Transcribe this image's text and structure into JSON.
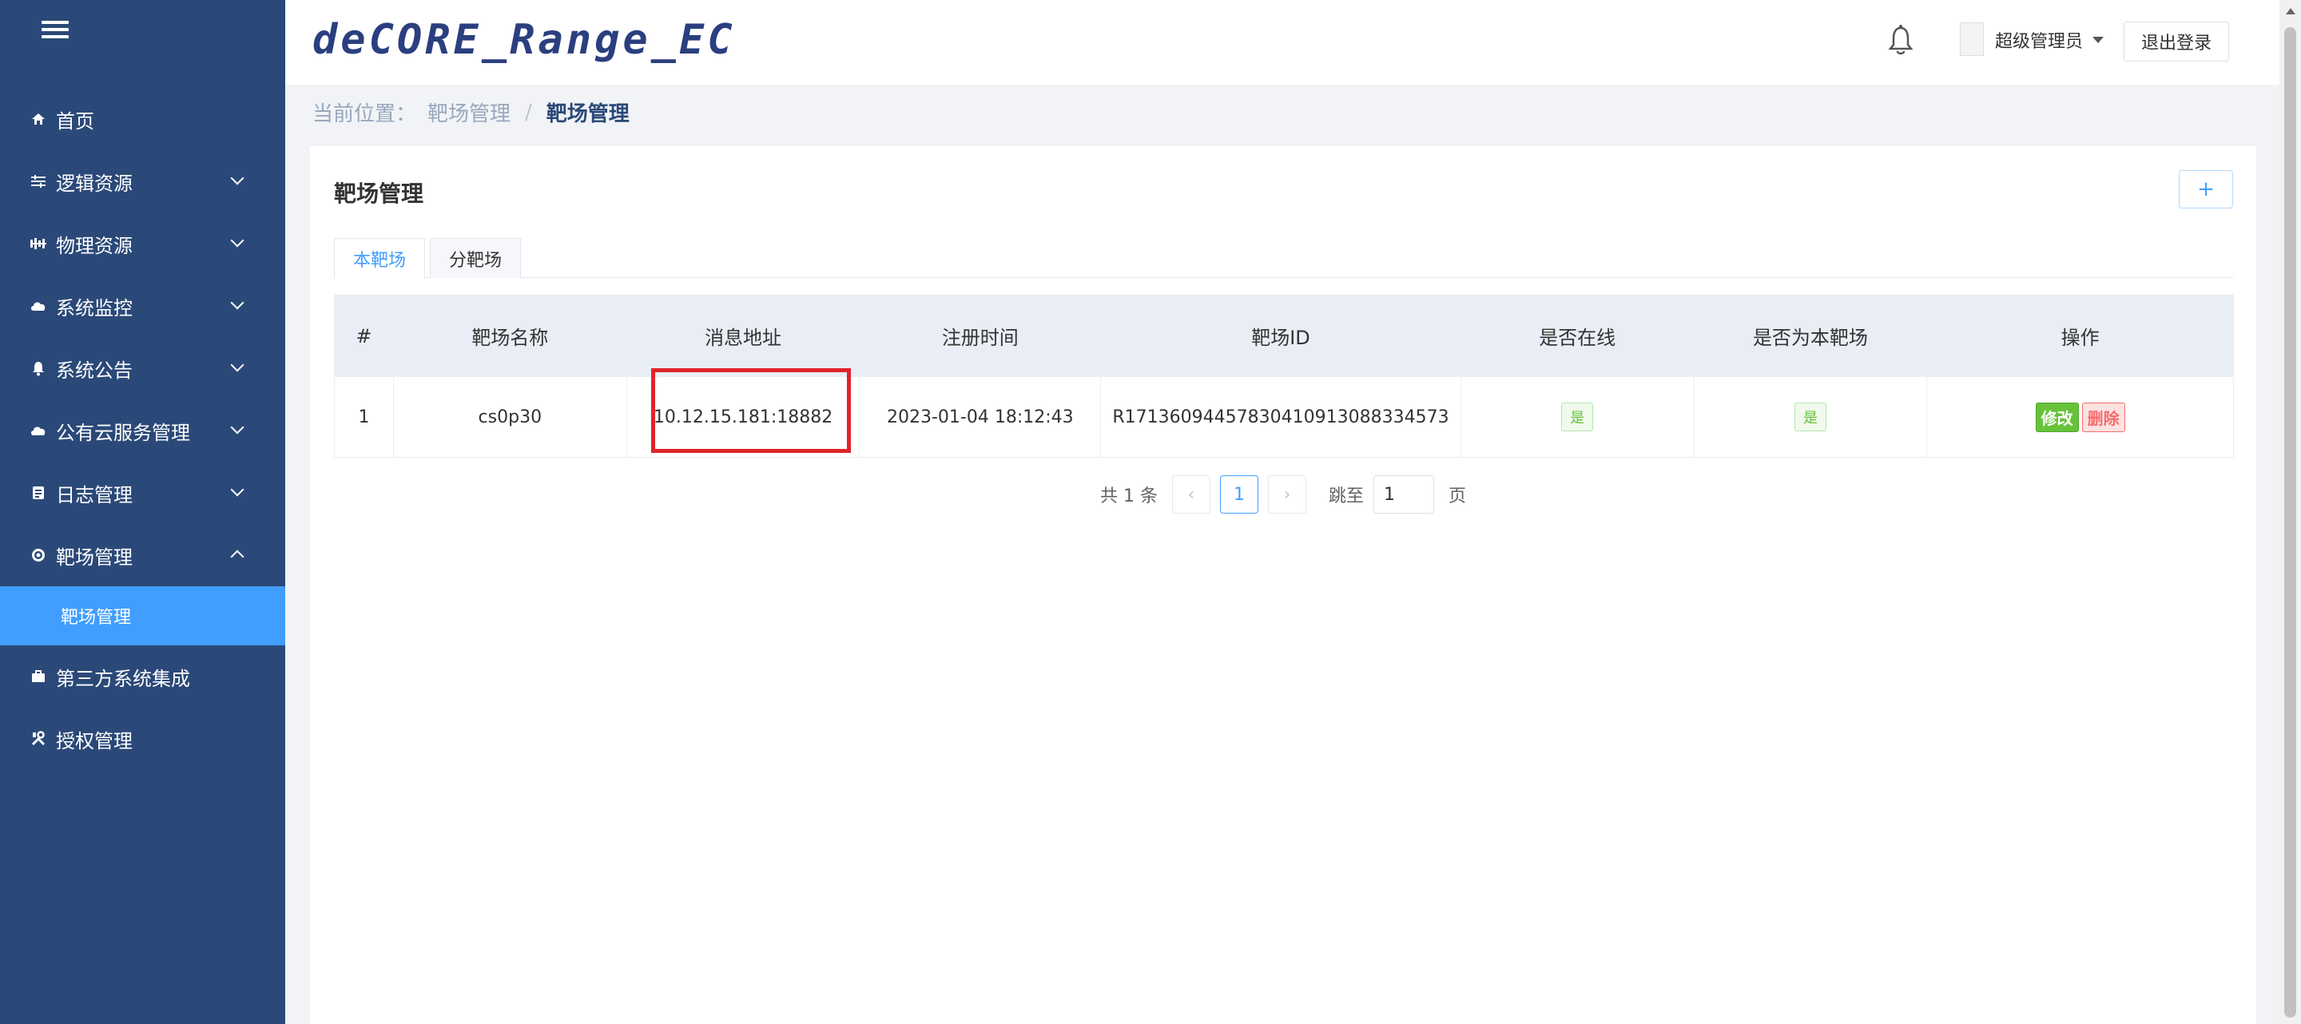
{
  "app": {
    "logo_text": "deCORE_Range_EC",
    "colors": {
      "sidebar": "#2b4978",
      "accent": "#409eff",
      "success": "#67c23a",
      "danger": "#f56c6c",
      "highlight": "#e0242a"
    }
  },
  "header": {
    "bell_icon": "bell-icon",
    "user_name": "超级管理员",
    "logout_label": "退出登录"
  },
  "sidebar": {
    "menu_icon": "hamburger-icon",
    "items": [
      {
        "label": "首页",
        "icon": "home-icon"
      },
      {
        "label": "逻辑资源",
        "icon": "sliders-icon"
      },
      {
        "label": "物理资源",
        "icon": "server-icon"
      },
      {
        "label": "系统监控",
        "icon": "cloud-icon"
      },
      {
        "label": "系统公告",
        "icon": "bell-icon"
      },
      {
        "label": "公有云服务管理",
        "icon": "cloud-icon"
      },
      {
        "label": "日志管理",
        "icon": "document-icon"
      },
      {
        "label": "靶场管理",
        "icon": "target-icon"
      },
      {
        "label": "第三方系统集成",
        "icon": "briefcase-icon"
      },
      {
        "label": "授权管理",
        "icon": "tools-icon"
      }
    ],
    "sub_item": "靶场管理"
  },
  "breadcrumb": {
    "label": "当前位置：",
    "parent": "靶场管理",
    "separator": "/",
    "current": "靶场管理"
  },
  "main": {
    "title": "靶场管理",
    "add_label": "+",
    "tabs": [
      "本靶场",
      "分靶场"
    ],
    "table": {
      "headers": [
        "#",
        "靶场名称",
        "消息地址",
        "注册时间",
        "靶场ID",
        "是否在线",
        "是否为本靶场",
        "操作"
      ],
      "rows": [
        {
          "index": "1",
          "name": "cs0p30",
          "address": "10.12.15.181:18882",
          "registered": "2023-01-04 18:12:43",
          "range_id": "R171360944578304109130883345 73",
          "online": "是",
          "is_local": "是",
          "edit": "修改",
          "delete": "删除"
        }
      ]
    },
    "pagination": {
      "total": "共 1 条",
      "prev": "‹",
      "page": "1",
      "next": "›",
      "goto": "跳至",
      "goto_value": "1",
      "page_unit": "页"
    }
  }
}
